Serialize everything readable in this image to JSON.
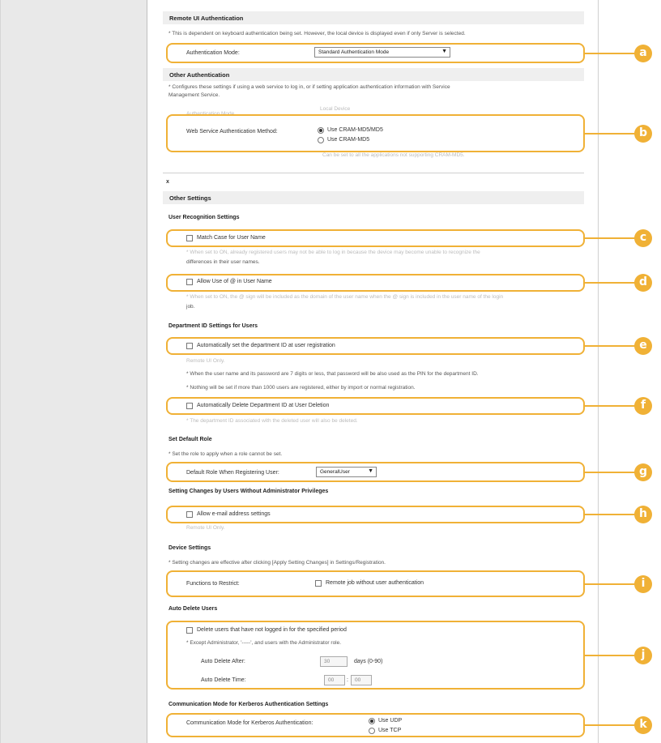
{
  "remote_ui": {
    "heading": "Remote UI Authentication",
    "note": "* This is dependent on keyboard authentication being set. However, the local device is displayed even if only Server is selected.",
    "mode_label": "Authentication Mode:",
    "mode_value": "Standard Authentication Mode"
  },
  "other_auth": {
    "heading": "Other Authentication",
    "note_line1": "* Configures these settings if using a web service to log in, or if setting application authentication information with Service",
    "note_line2": "Management Service.",
    "ghost_top": "Authentication Mode",
    "ghost_right": "Local Device",
    "method_label": "Web Service Authentication Method:",
    "option1": "Use CRAM-MD5/MD5",
    "option2": "Use CRAM-MD5",
    "ghost_bottom": "Can be set to all the applications not supporting CRAM-MD5."
  },
  "misc": {
    "glyph": "x"
  },
  "other_settings": {
    "heading": "Other Settings"
  },
  "user_recognition": {
    "heading": "User Recognition Settings",
    "match_case_label": "Match Case for User Name",
    "ghost_note": "* When set to ON, already registered users may not be able to log in because the device may become unable to recognize the",
    "note2": "differences in their user names.",
    "allow_at_label": "Allow Use of @ in User Name",
    "ghost_note2": "* When set to ON, the @ sign will be included as the domain of the user name when the @ sign is included in the user name of the login",
    "note3": "job."
  },
  "dept_id": {
    "heading": "Department ID Settings for Users",
    "auto_set_label": "Automatically set the department ID at user registration",
    "remote_only": "Remote UI Only.",
    "note1": "* When the user name and its password are 7 digits or less, that password will be also used as the PIN for the department ID.",
    "note2": "* Nothing will be set if more than 1000 users are registered, either by import or normal registration.",
    "auto_delete_label": "Automatically Delete Department ID at User Deletion",
    "ghost_note": "* The department ID associated with the deleted user will also be deleted."
  },
  "default_role": {
    "heading": "Set Default Role",
    "note": "* Set the role to apply when a role cannot be set.",
    "label": "Default Role When Registering User:",
    "value": "GeneralUser"
  },
  "setting_changes": {
    "heading": "Setting Changes by Users Without Administrator Privileges",
    "email_label": "Allow e-mail address settings",
    "remote_only": "Remote UI Only."
  },
  "device_settings": {
    "heading": "Device Settings",
    "note": "* Setting changes are effective after clicking [Apply Setting Changes] in Settings/Registration.",
    "restrict_label": "Functions to Restrict:",
    "remote_job_label": "Remote job without user authentication"
  },
  "auto_delete": {
    "heading": "Auto Delete Users",
    "checkbox_label": "Delete users that have not logged in for the specified period",
    "note": "* Except Administrator, '-----', and users with the Administrator role.",
    "after_label": "Auto Delete After:",
    "after_value": "30",
    "after_unit": "days (0-90)",
    "time_label": "Auto Delete Time:",
    "time_hour": "00",
    "time_sep": ":",
    "time_min": "00"
  },
  "kerberos": {
    "heading": "Communication Mode for Kerberos Authentication Settings",
    "label": "Communication Mode for Kerberos Authentication:",
    "option1": "Use UDP",
    "option2": "Use TCP"
  },
  "markers": [
    "a",
    "b",
    "c",
    "d",
    "e",
    "f",
    "g",
    "h",
    "i",
    "j",
    "k"
  ],
  "colors": {
    "accent": "#f0b136",
    "header_bg": "#efefef",
    "side_bg": "#e9e9e9"
  }
}
